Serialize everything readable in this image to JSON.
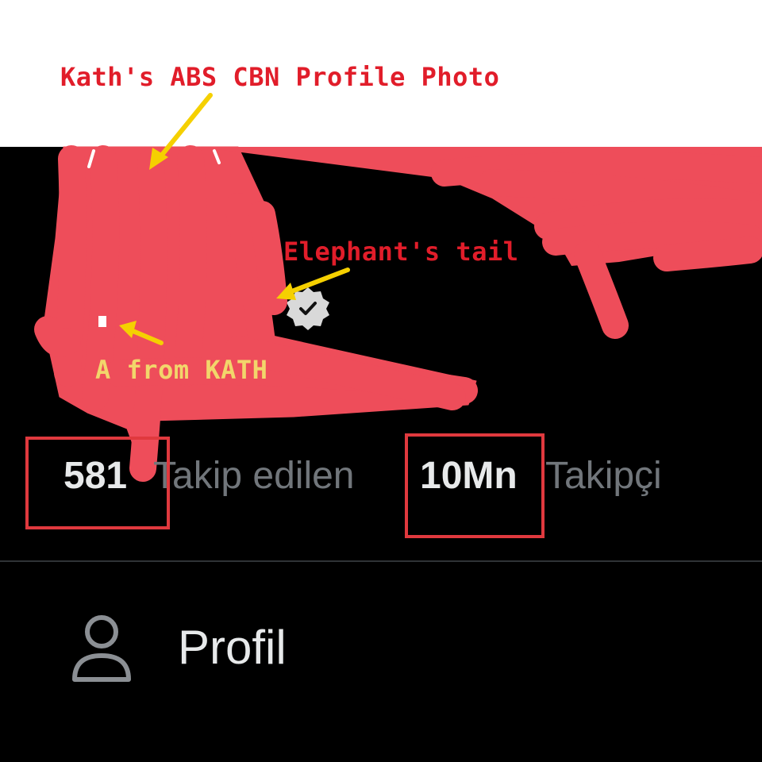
{
  "annotations": {
    "profile_photo": "Kath's ABS CBN Profile Photo",
    "elephant_tail": "Elephant's tail",
    "a_from_kath": "A from KATH"
  },
  "stats": {
    "following": {
      "count": "581",
      "label": "Takip edilen"
    },
    "followers": {
      "count": "10Mn",
      "label": "Takipçi"
    }
  },
  "menu": {
    "profile_label": "Profil",
    "profile_icon": "person-icon"
  },
  "icons": {
    "verified": "verified-badge-icon"
  },
  "colors": {
    "background": "#000000",
    "scribble": "#ee4d5a",
    "annotation_red": "#e11d2a",
    "annotation_yellow": "#f2d66b",
    "arrow_yellow": "#f5d000",
    "highlight_box": "#e0393e",
    "text_primary": "#e7e9ea",
    "text_secondary": "#71767b"
  }
}
